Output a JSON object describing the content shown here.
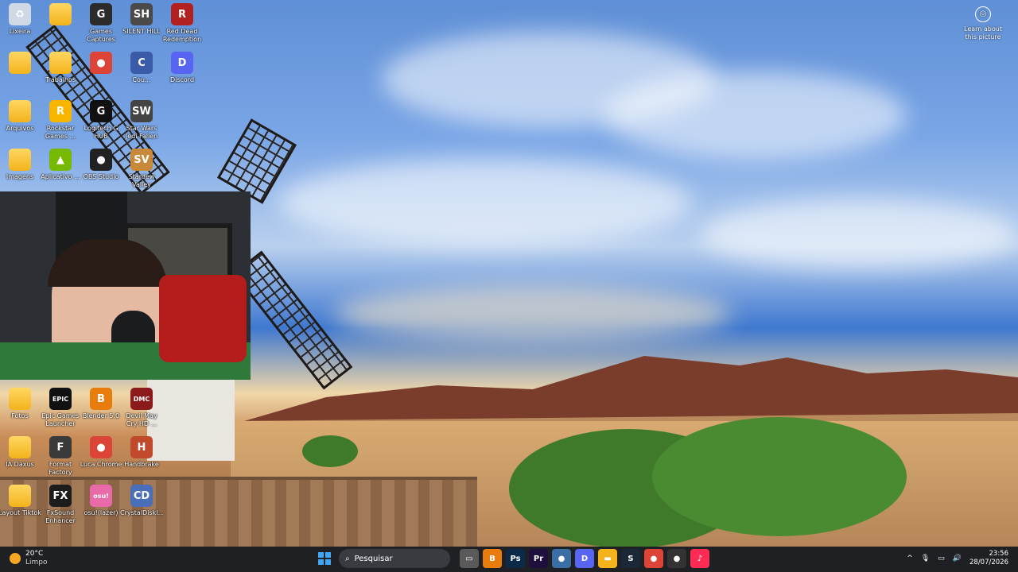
{
  "desktop": {
    "learn_label": "Learn about this picture",
    "icons_top": [
      {
        "label": "Lixeira",
        "col": 0,
        "row": 0,
        "icon": "recycle-bin-icon",
        "color": "#cfd9e6",
        "glyph": "♻"
      },
      {
        "label": "",
        "col": 1,
        "row": 0,
        "icon": "folder-icon",
        "color": "folder",
        "glyph": ""
      },
      {
        "label": "Games Captures",
        "col": 2,
        "row": 0,
        "icon": "capture-icon",
        "color": "#2b2b2b",
        "glyph": "G"
      },
      {
        "label": "SILENT HILL",
        "col": 3,
        "row": 0,
        "icon": "game-icon",
        "color": "#4a4a4a",
        "glyph": "SH"
      },
      {
        "label": "Red Dead Redemption",
        "col": 4,
        "row": 0,
        "icon": "game-icon",
        "color": "#b32020",
        "glyph": "R"
      },
      {
        "label": "",
        "col": 0,
        "row": 1,
        "icon": "folder-icon",
        "color": "folder",
        "glyph": ""
      },
      {
        "label": "Trabalhos",
        "col": 1,
        "row": 1,
        "icon": "folder-icon",
        "color": "folder",
        "glyph": ""
      },
      {
        "label": "",
        "col": 2,
        "row": 1,
        "icon": "chrome-icon",
        "color": "#db4437",
        "glyph": "●"
      },
      {
        "label": "Cou...",
        "col": 3,
        "row": 1,
        "icon": "app-icon",
        "color": "#3a5ba8",
        "glyph": "C"
      },
      {
        "label": "Discord",
        "col": 4,
        "row": 1,
        "icon": "discord-icon",
        "color": "#5865f2",
        "glyph": "D"
      },
      {
        "label": "Arquivos",
        "col": 0,
        "row": 2,
        "icon": "folder-icon",
        "color": "folder",
        "glyph": ""
      },
      {
        "label": "Rockstar Games ...",
        "col": 1,
        "row": 2,
        "icon": "rockstar-icon",
        "color": "#f7b500",
        "glyph": "R"
      },
      {
        "label": "Logitech G HUB",
        "col": 2,
        "row": 2,
        "icon": "ghub-icon",
        "color": "#111",
        "glyph": "G"
      },
      {
        "label": "Star Wars Jedi Fallen",
        "col": 3,
        "row": 2,
        "icon": "game-icon",
        "color": "#444",
        "glyph": "SW"
      },
      {
        "label": "Imagens",
        "col": 0,
        "row": 3,
        "icon": "folder-icon",
        "color": "folder",
        "glyph": ""
      },
      {
        "label": "Aplicativo ...",
        "col": 1,
        "row": 3,
        "icon": "nvidia-icon",
        "color": "#76b900",
        "glyph": "▲"
      },
      {
        "label": "OBS Studio",
        "col": 2,
        "row": 3,
        "icon": "obs-icon",
        "color": "#222",
        "glyph": "●"
      },
      {
        "label": "Stardew Valley",
        "col": 3,
        "row": 3,
        "icon": "game-icon",
        "color": "#c88a3a",
        "glyph": "SV"
      }
    ],
    "icons_bottom": [
      {
        "label": "Fotos",
        "col": 0,
        "row": 0,
        "icon": "folder-icon",
        "color": "folder",
        "glyph": ""
      },
      {
        "label": "Epic Games Launcher",
        "col": 1,
        "row": 0,
        "icon": "epic-icon",
        "color": "#111",
        "glyph": "EPIC"
      },
      {
        "label": "Blender 5.0",
        "col": 2,
        "row": 0,
        "icon": "blender-icon",
        "color": "#e87d0d",
        "glyph": "B"
      },
      {
        "label": "Devil May Cry HD ...",
        "col": 3,
        "row": 0,
        "icon": "game-icon",
        "color": "#8b1b1b",
        "glyph": "DMC"
      },
      {
        "label": "IA Daxus",
        "col": 0,
        "row": 1,
        "icon": "folder-icon",
        "color": "folder",
        "glyph": ""
      },
      {
        "label": "Format Factory",
        "col": 1,
        "row": 1,
        "icon": "format-factory-icon",
        "color": "#3a3a3a",
        "glyph": "F"
      },
      {
        "label": "Luca Chrome",
        "col": 2,
        "row": 1,
        "icon": "chrome-icon",
        "color": "#db4437",
        "glyph": "●"
      },
      {
        "label": "Handbrake",
        "col": 3,
        "row": 1,
        "icon": "handbrake-icon",
        "color": "#c04a2b",
        "glyph": "H"
      },
      {
        "label": "Layout Tiktok",
        "col": 0,
        "row": 2,
        "icon": "folder-icon",
        "color": "folder",
        "glyph": ""
      },
      {
        "label": "FxSound Enhancer",
        "col": 1,
        "row": 2,
        "icon": "fxsound-icon",
        "color": "#1c1c1c",
        "glyph": "FX"
      },
      {
        "label": "osu!(lazer)",
        "col": 2,
        "row": 2,
        "icon": "osu-icon",
        "color": "#e86aa8",
        "glyph": "osu!"
      },
      {
        "label": "CrystalDiskI...",
        "col": 3,
        "row": 2,
        "icon": "crystaldisk-icon",
        "color": "#4a6fb8",
        "glyph": "CD"
      }
    ]
  },
  "taskbar": {
    "temperature": "20°C",
    "weather": "Limpo",
    "search_placeholder": "Pesquisar",
    "apps": [
      {
        "name": "task-view-icon",
        "glyph": "▭",
        "color": "#5a5a5a"
      },
      {
        "name": "blender-icon",
        "glyph": "B",
        "color": "#e87d0d"
      },
      {
        "name": "photoshop-icon",
        "glyph": "Ps",
        "color": "#0b2a4a"
      },
      {
        "name": "premiere-icon",
        "glyph": "Pr",
        "color": "#1f0f3f"
      },
      {
        "name": "app-icon",
        "glyph": "●",
        "color": "#3a6ea5"
      },
      {
        "name": "discord-icon",
        "glyph": "D",
        "color": "#5865f2"
      },
      {
        "name": "file-explorer-icon",
        "glyph": "▬",
        "color": "#f2b31c"
      },
      {
        "name": "steam-icon",
        "glyph": "S",
        "color": "#1b2838"
      },
      {
        "name": "chrome-icon",
        "glyph": "●",
        "color": "#db4437"
      },
      {
        "name": "obs-icon",
        "glyph": "●",
        "color": "#333"
      },
      {
        "name": "tiktok-icon",
        "glyph": "♪",
        "color": "#fe2c55"
      }
    ],
    "time": "23:56",
    "date": "28/07/2026"
  }
}
